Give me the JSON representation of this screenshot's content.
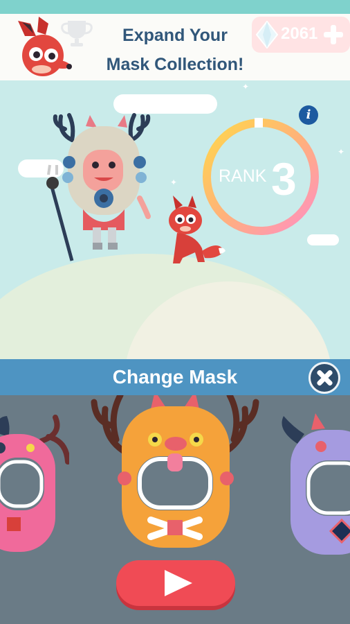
{
  "header": {
    "title_line1": "Expand Your",
    "title_line2": "Mask Collection!",
    "gems": "2061"
  },
  "rank": {
    "label": "RANK",
    "value": "3",
    "info": "i"
  },
  "panel": {
    "title": "Change Mask"
  },
  "icons": {
    "header_logo": "red-fox-mascot-icon",
    "trophy": "trophy-icon",
    "gem": "diamond-gem-icon",
    "plus": "plus-icon",
    "close": "close-icon",
    "play": "play-icon"
  },
  "masks": [
    {
      "name": "pink-mask",
      "selected": false
    },
    {
      "name": "orange-antler-mask",
      "selected": true
    },
    {
      "name": "purple-horned-mask",
      "selected": false
    }
  ],
  "colors": {
    "header_text": "#31577a",
    "panel_bar": "#4e94c2",
    "play_button": "#f04b55",
    "scene_sky": "#c9ebea"
  }
}
